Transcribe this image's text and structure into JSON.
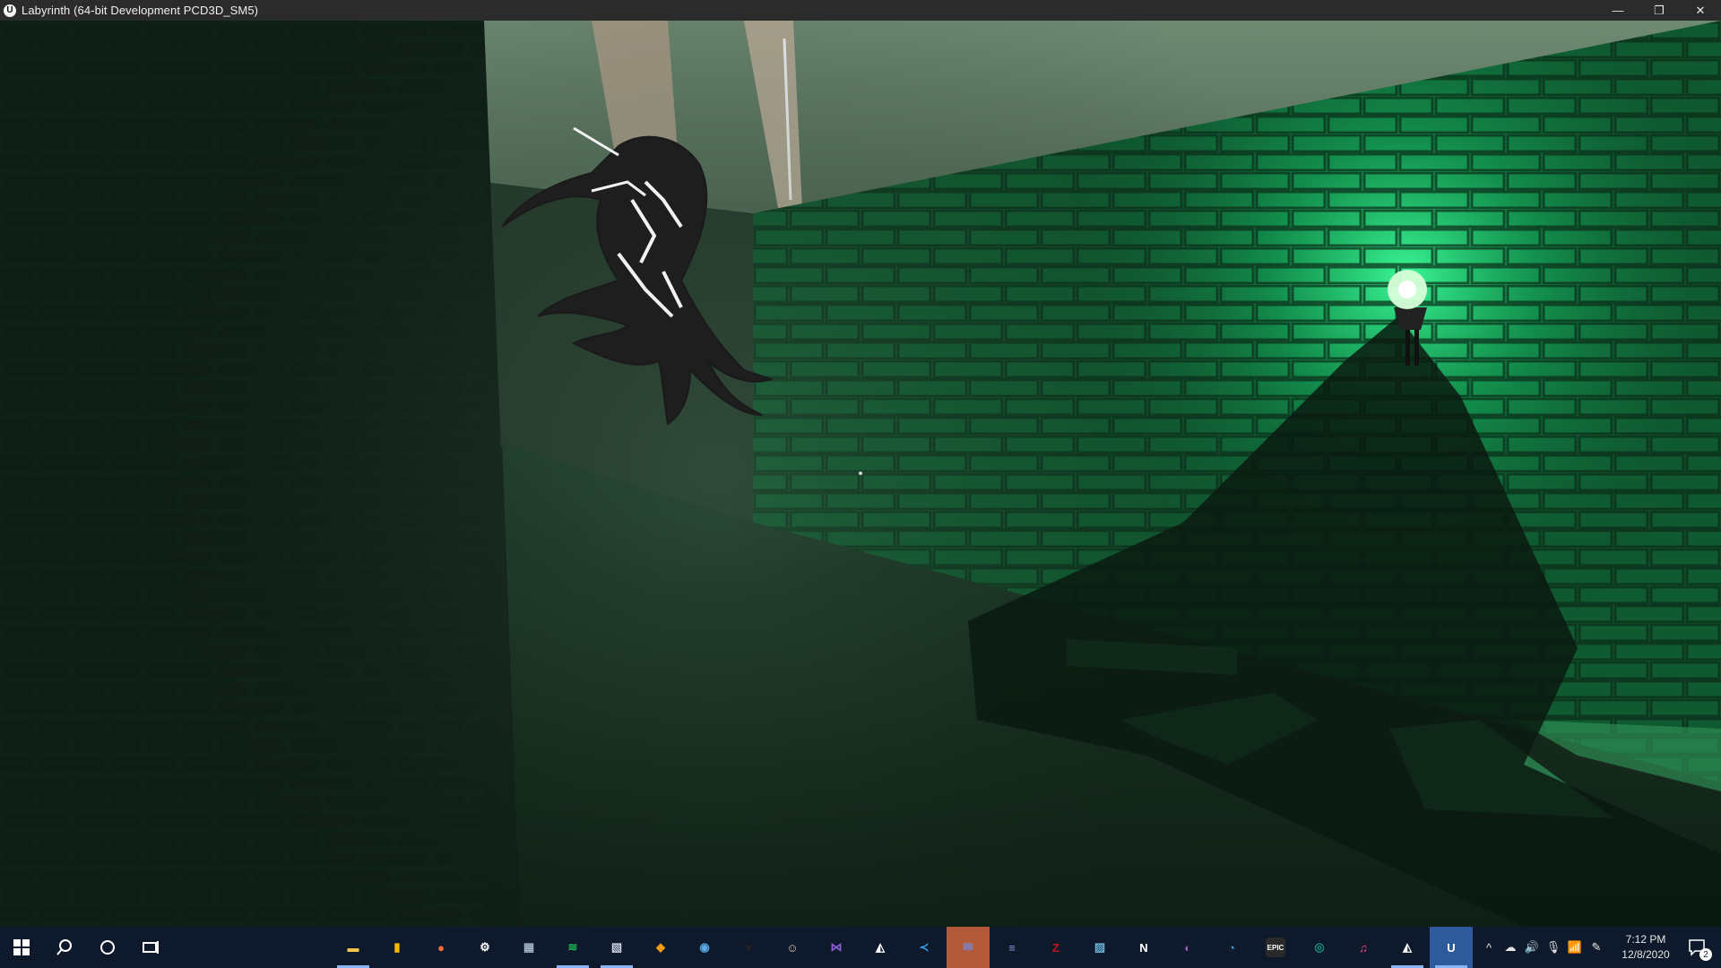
{
  "window": {
    "title": "Labyrinth (64-bit Development PCD3D_SM5)",
    "app_icon_letter": "U",
    "controls": {
      "minimize": "—",
      "restore": "❐",
      "close": "✕"
    }
  },
  "scene": {
    "description_icon": "game-viewport",
    "accent_color": "#1fa35a"
  },
  "taskbar": {
    "start_icon": "windows-start-icon",
    "apps": [
      {
        "name": "file-explorer",
        "glyph": "▬",
        "color": "#f2c94c"
      },
      {
        "name": "files-app",
        "glyph": "▮",
        "color": "#f5b700"
      },
      {
        "name": "firefox",
        "glyph": "●",
        "color": "#ff7139"
      },
      {
        "name": "settings",
        "glyph": "⚙",
        "color": "#ffffff"
      },
      {
        "name": "calculator",
        "glyph": "▦",
        "color": "#9fb3c8"
      },
      {
        "name": "spotify",
        "glyph": "≋",
        "color": "#1db954"
      },
      {
        "name": "photos",
        "glyph": "▧",
        "color": "#c8d3e0"
      },
      {
        "name": "sourcetree",
        "glyph": "◆",
        "color": "#f39c12"
      },
      {
        "name": "steam",
        "glyph": "◉",
        "color": "#5aa9e6"
      },
      {
        "name": "destiny",
        "glyph": "▼",
        "color": "#222222"
      },
      {
        "name": "anime-app",
        "glyph": "☺",
        "color": "#e8c4b0"
      },
      {
        "name": "visual-studio",
        "glyph": "⋈",
        "color": "#8e5bd6"
      },
      {
        "name": "unity",
        "glyph": "◭",
        "color": "#ffffff"
      },
      {
        "name": "vscode",
        "glyph": "≺",
        "color": "#2f9be6"
      },
      {
        "name": "discord-badge",
        "glyph": "✉",
        "color": "#7289da"
      },
      {
        "name": "linear-app",
        "glyph": "≡",
        "color": "#8a8fd8"
      },
      {
        "name": "filezilla",
        "glyph": "Z",
        "color": "#c0161b"
      },
      {
        "name": "image-viewer",
        "glyph": "▨",
        "color": "#6bb3d9"
      },
      {
        "name": "notion",
        "glyph": "N",
        "color": "#ffffff"
      },
      {
        "name": "paint-app",
        "glyph": "◐",
        "color": "#9b59b6"
      },
      {
        "name": "steam-vr",
        "glyph": "◔",
        "color": "#4aa3df"
      },
      {
        "name": "epic-games",
        "glyph": "EPIC",
        "color": "#222222"
      },
      {
        "name": "gitkraken",
        "glyph": "◎",
        "color": "#179287"
      },
      {
        "name": "itunes",
        "glyph": "♫",
        "color": "#ea4c89"
      },
      {
        "name": "unity-hub",
        "glyph": "◭",
        "color": "#ffffff"
      },
      {
        "name": "unreal-engine",
        "glyph": "U",
        "color": "#ffffff"
      }
    ],
    "tray": {
      "chevron": "^",
      "onedrive": "☁",
      "volume": "🔊",
      "mic": "🎙",
      "wifi": "📶",
      "pen": "✎"
    },
    "clock": {
      "time": "7:12 PM",
      "date": "12/8/2020"
    },
    "notification_count": "2"
  }
}
